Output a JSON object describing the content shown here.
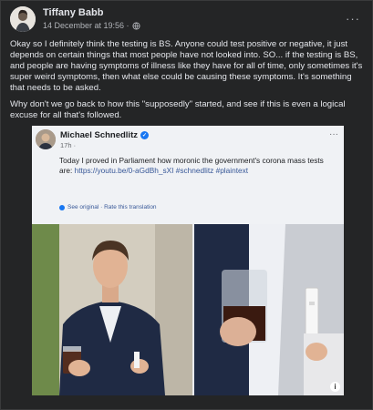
{
  "post": {
    "author": "Tiffany Babb",
    "timestamp": "14 December at 19:56 ·",
    "more_icon": "···",
    "paragraphs": [
      "Okay so I definitely think the testing is BS. Anyone could test positive or negative, it just depends on certain things that most people have not looked into. SO... if the testing is BS, and people are having symptoms of illness like they have for all of time, only sometimes it's super weird symptoms, then what else could be causing these symptoms. It's something that needs to be asked.",
      "Why don't we go back to how this \"supposedly\" started, and see if this is even a logical excuse for all that's followed."
    ]
  },
  "shared": {
    "author": "Michael Schnedlitz",
    "verified_mark": "✓",
    "time": "17h ·",
    "more_icon": "···",
    "text_main": "Today I proved in Parliament how moronic the government's corona mass tests are: ",
    "text_link": "https://youtu.be/0-aGdBh_sXI #schnedlitz #plaintext",
    "see_original": "See original · Rate this translation",
    "info_badge": "i"
  },
  "colors": {
    "background": "#18191a",
    "card": "#242526",
    "text": "#e4e6eb",
    "secondary_text": "#b0b3b8",
    "link": "#385898",
    "verified": "#1877f2"
  }
}
